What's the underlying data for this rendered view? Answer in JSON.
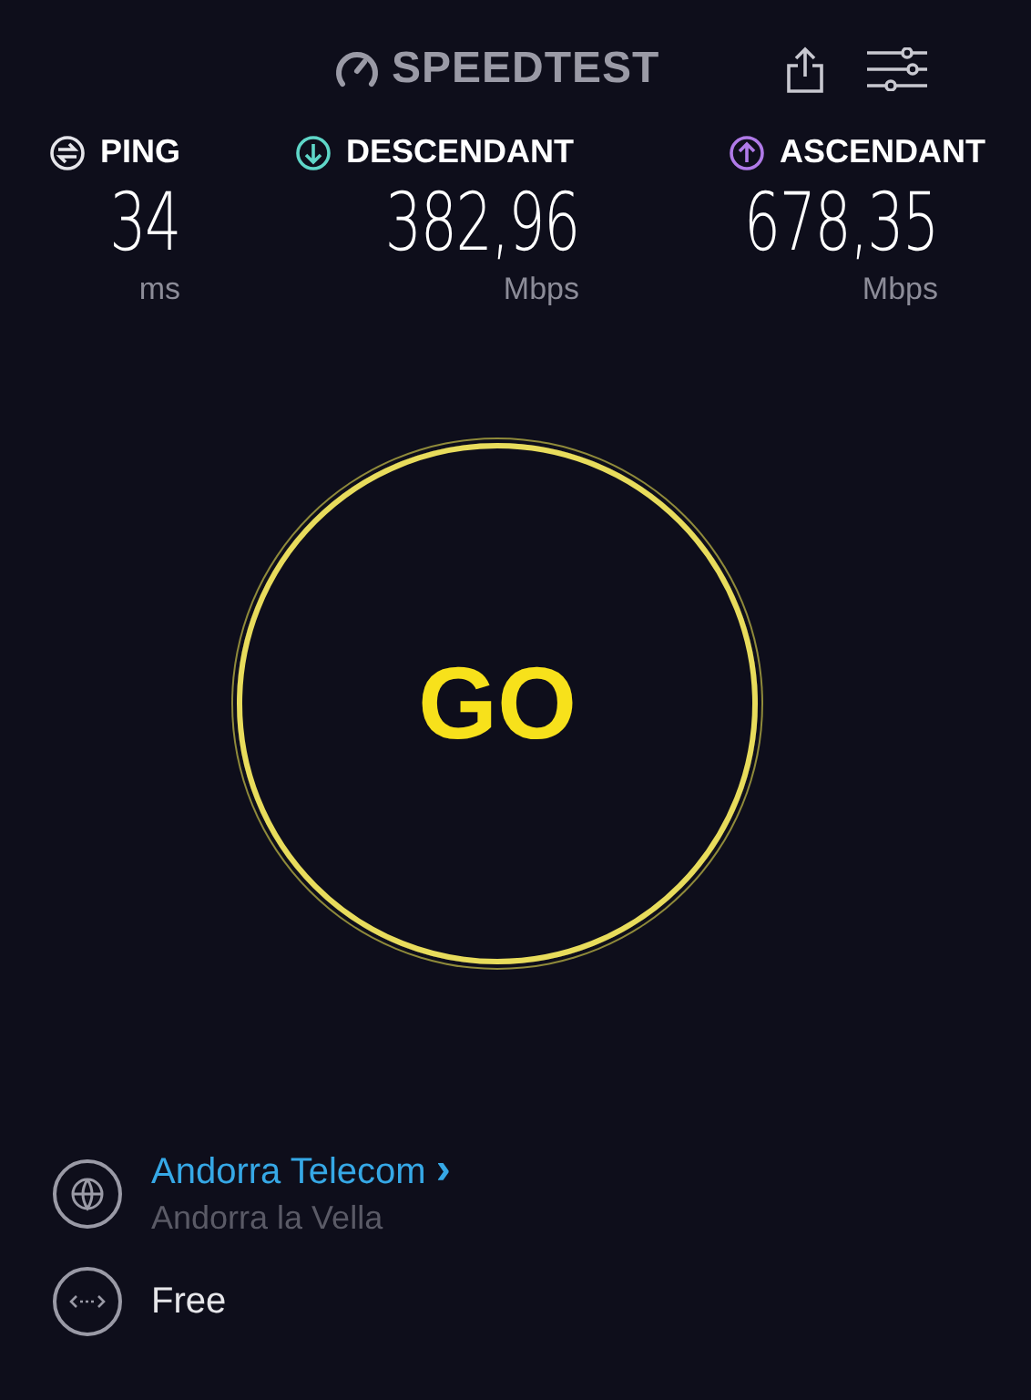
{
  "header": {
    "logo_text": "SPEEDTEST"
  },
  "metrics": [
    {
      "label": "PING",
      "value": "34",
      "unit": "ms",
      "color": "#e5e5ea",
      "kind": "ping"
    },
    {
      "label": "DESCENDANT",
      "value": "382,96",
      "unit": "Mbps",
      "color": "#5fd6c8",
      "kind": "download"
    },
    {
      "label": "ASCENDANT",
      "value": "678,35",
      "unit": "Mbps",
      "color": "#b07ae8",
      "kind": "upload"
    }
  ],
  "go_button": {
    "label": "GO"
  },
  "provider": {
    "name": "Andorra Telecom",
    "chevron": "›",
    "location": "Andorra la Vella"
  },
  "connection": {
    "label": "Free"
  }
}
